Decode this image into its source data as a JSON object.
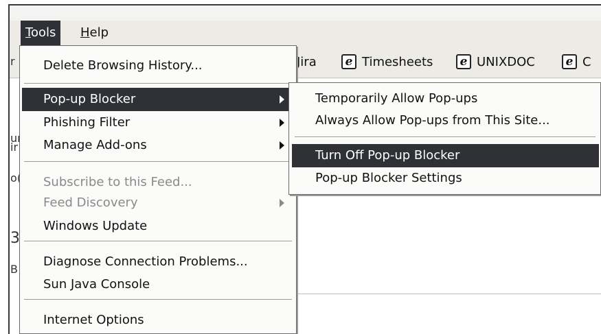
{
  "menubar": {
    "tools": {
      "prefix": "",
      "accel": "T",
      "rest": "ools"
    },
    "help": {
      "accel": "H",
      "rest": "elp"
    }
  },
  "links_bar": {
    "partial_left": "Jira",
    "items": [
      "Timesheets",
      "UNIXDOC",
      "C"
    ],
    "icon": "ie-page-icon",
    "icon_glyph": "e"
  },
  "left_fragments": [
    "r",
    "ur",
    "ir",
    "o(",
    "3",
    "B"
  ],
  "tools_menu": {
    "items": [
      {
        "label": "Delete Browsing History...",
        "state": "normal"
      },
      {
        "label": "Pop-up Blocker",
        "state": "selected",
        "submenu": true
      },
      {
        "label": "Phishing Filter",
        "state": "normal",
        "submenu": true
      },
      {
        "label": "Manage Add-ons",
        "state": "normal",
        "submenu": true
      },
      {
        "label": "Subscribe to this Feed...",
        "state": "disabled"
      },
      {
        "label": "Feed Discovery",
        "state": "disabled",
        "submenu": true
      },
      {
        "label": "Windows Update",
        "state": "normal"
      },
      {
        "label": "Diagnose Connection Problems...",
        "state": "normal"
      },
      {
        "label": "Sun Java Console",
        "state": "normal"
      },
      {
        "label": "Internet Options",
        "state": "normal"
      }
    ]
  },
  "popup_submenu": {
    "items": [
      {
        "label": "Temporarily Allow Pop-ups",
        "state": "normal"
      },
      {
        "label": "Always Allow Pop-ups from This Site...",
        "state": "normal"
      },
      {
        "label": "Turn Off Pop-up Blocker",
        "state": "selected"
      },
      {
        "label": "Pop-up Blocker Settings",
        "state": "normal"
      }
    ]
  },
  "colors": {
    "highlight": "#2f3136",
    "menu_bg": "#fbfbfa",
    "toolbar_bg": "#ecebe6"
  }
}
